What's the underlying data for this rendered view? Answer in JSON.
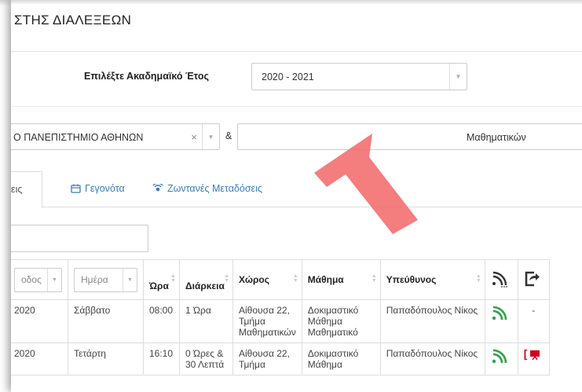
{
  "header": {
    "title": "ΣΤΗΣ ΔΙΑΛΕΞΕΩΝ"
  },
  "filters": {
    "year_label": "Επιλέξτε Ακαδημαϊκό Έτος",
    "year_value": "2020 - 2021",
    "university_value": "Ο ΠΑΝΕΠΙΣΤΗΜΙΟ ΑΘΗΝΩΝ",
    "clear_symbol": "×",
    "ampersand": "&",
    "department_value": "Μαθηματικών"
  },
  "tabs": [
    {
      "label": "εις"
    },
    {
      "label": "Γεγονότα"
    },
    {
      "label": "Ζωντανές Μεταδόσεις"
    }
  ],
  "table": {
    "headers": {
      "period": "οδος",
      "day": "Ημέρα",
      "time": "Ώρα",
      "duration": "Διάρκεια",
      "room": "Χώρος",
      "course": "Μάθημα",
      "responsible": "Υπεύθυνος"
    },
    "rows": [
      {
        "period": "2020",
        "day": "Σάββατο",
        "time": "08:00",
        "duration": "1 Ώρα",
        "room": "Αίθουσα 22, Τμήμα Μαθηματικών",
        "course": "Δοκιμαστικό Μάθημα Μαθηματικό",
        "responsible": "Παπαδόπουλος Νίκος",
        "share": "-"
      },
      {
        "period": "2020",
        "day": "Τετάρτη",
        "time": "16:10",
        "duration": "0 Ώρες & 30 Λεπτά",
        "room": "Αίθουσα 22, Τμήμα",
        "course": "Δοκιμαστικό Μάθημα",
        "responsible": "Παπαδόπουλος Νίκος",
        "share": "["
      }
    ]
  },
  "colors": {
    "link": "#3a7cc2",
    "rss": "#2ea34a",
    "arrow": "#f26b6b",
    "alert": "#d0021b"
  }
}
